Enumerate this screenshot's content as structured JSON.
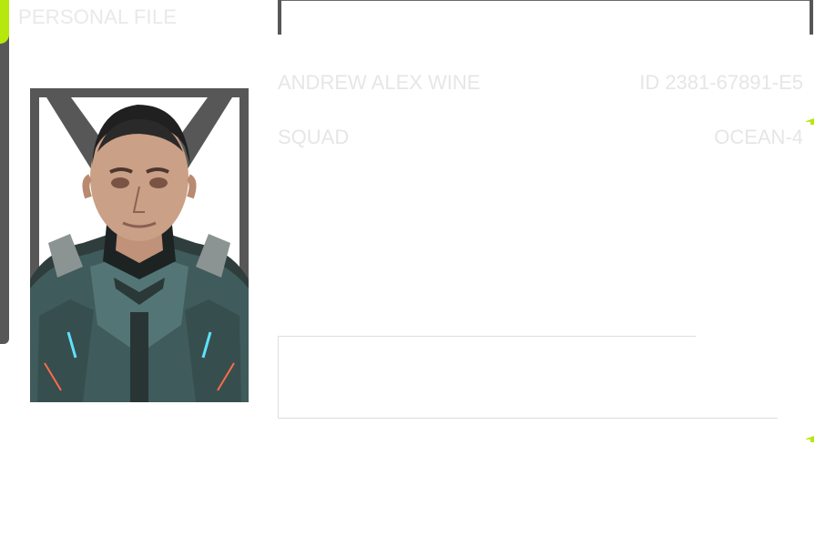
{
  "header": {
    "title": "PERSONAL FILE"
  },
  "profile": {
    "name": "ANDREW ALEX WINE",
    "id": "ID 2381-67891-E5",
    "squad_label": "SQUAD",
    "squad_value": "OCEAN-4"
  },
  "colors": {
    "accent": "#b6e80d",
    "frame": "#575757",
    "text": "#e6e6e6"
  },
  "icons": {
    "portrait": "soldier-portrait"
  }
}
